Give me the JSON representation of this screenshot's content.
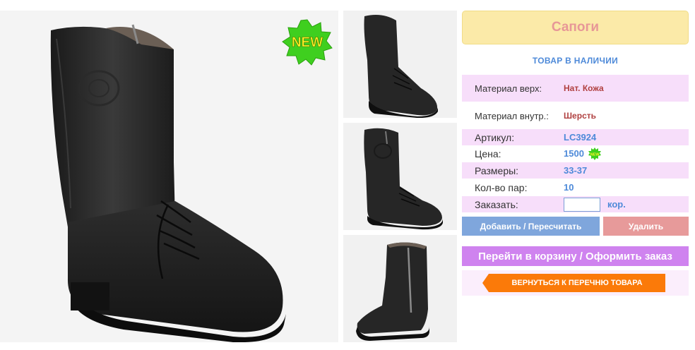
{
  "product": {
    "title": "Сапоги",
    "stock_status": "ТОВАР В НАЛИЧИИ",
    "badge_main": "NEW",
    "specs": [
      {
        "label": "Материал верх:",
        "value": "Нат. Кожа"
      },
      {
        "label": "Материал внутр.:",
        "value": "Шерсть"
      }
    ],
    "article": {
      "label": "Артикул:",
      "value": "LC3924"
    },
    "price": {
      "label": "Цена:",
      "value": "1500",
      "badge": "NEW"
    },
    "sizes": {
      "label": "Размеры:",
      "value": "33-37"
    },
    "pairs": {
      "label": "Кол-во пар:",
      "value": "10"
    },
    "order": {
      "label": "Заказать:",
      "input_value": "",
      "unit": "кор."
    }
  },
  "buttons": {
    "add": "Добавить / Пересчитать",
    "delete": "Удалить",
    "cart": "Перейти в корзину / Оформить заказ",
    "back": "ВЕРНУТЬСЯ К ПЕРЕЧНЮ ТОВАРА"
  },
  "colors": {
    "title_bg": "#fbeaa8",
    "title_text": "#e79797",
    "accent_blue": "#4e8ad9",
    "row_pink": "#f7defa",
    "add_button": "#7fa6dc",
    "delete_button": "#e79a9a",
    "cart_button": "#cf83ef",
    "back_button": "#fb7a09",
    "badge_green": "#3fcf1f"
  },
  "images": {
    "main": "boot-photo-side-view",
    "thumbnails": [
      "boot-thumb-angle",
      "boot-thumb-front",
      "boot-thumb-inner-zip"
    ]
  }
}
